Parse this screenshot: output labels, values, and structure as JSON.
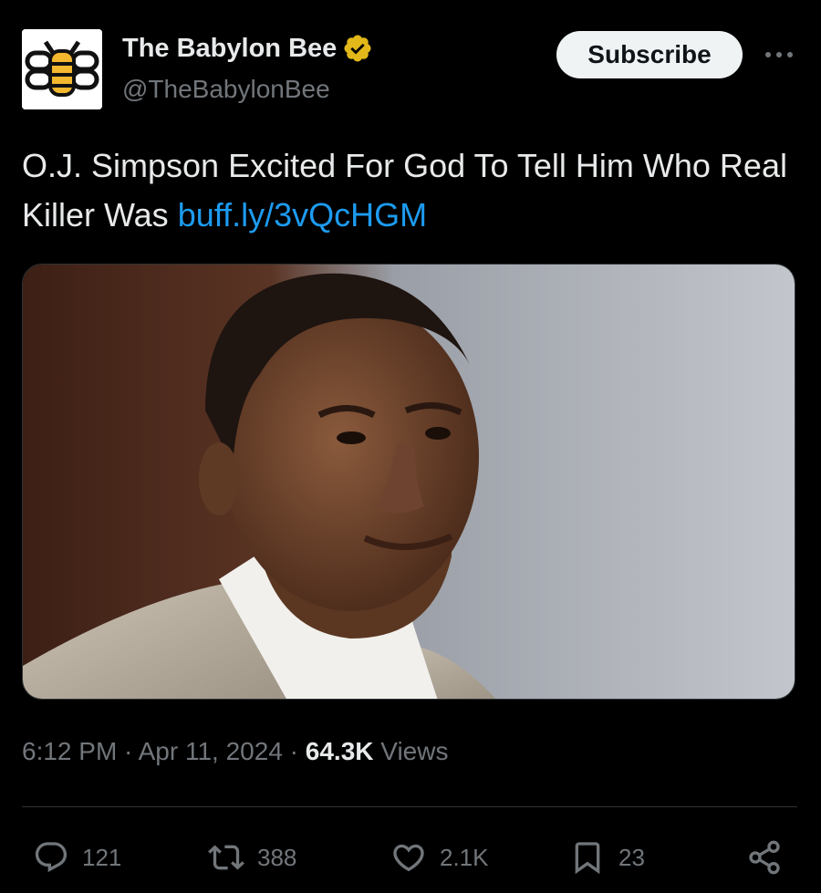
{
  "author": {
    "display_name": "The Babylon Bee",
    "handle": "@TheBabylonBee",
    "verified_icon": "verified-badge-gold-icon",
    "avatar_icon": "babylon-bee-logo"
  },
  "header": {
    "subscribe_label": "Subscribe",
    "more_icon": "more-horizontal-icon"
  },
  "tweet": {
    "text": "O.J. Simpson Excited For God To Tell Him Who Real Killer Was ",
    "link": "buff.ly/3vQcHGM"
  },
  "meta": {
    "time": "6:12 PM",
    "separator": " · ",
    "date": "Apr 11, 2024",
    "views_count": "64.3K",
    "views_label": "Views"
  },
  "actions": {
    "replies": "121",
    "reposts": "388",
    "likes": "2.1K",
    "bookmarks": "23"
  },
  "colors": {
    "background": "#000000",
    "text_primary": "#e7e9ea",
    "text_secondary": "#71767b",
    "link": "#1d9bf0",
    "verified_gold": "#e2b719",
    "divider": "#2f3336"
  }
}
